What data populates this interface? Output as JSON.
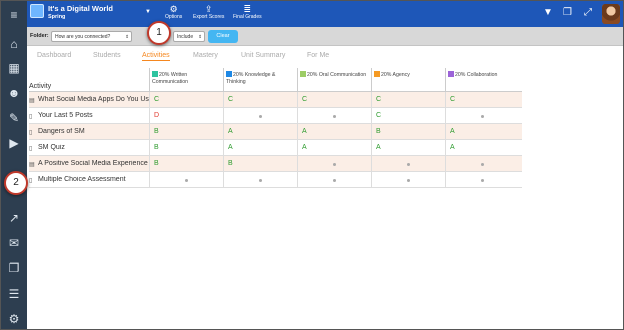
{
  "header": {
    "class_title": "It's a Digital World",
    "class_subtitle": "Spring",
    "buttons": [
      {
        "label": "Options",
        "icon": "gears-icon"
      },
      {
        "label": "Export Scores",
        "icon": "upload-icon"
      },
      {
        "label": "Final Grades",
        "icon": "list-icon"
      }
    ],
    "right_icons": [
      "filter-icon",
      "copy-icon",
      "expand-icon"
    ]
  },
  "filters": {
    "folder_label": "Folder:",
    "folder_value": "How are you connected?",
    "include_value": "Include",
    "clear_label": "Clear"
  },
  "tabs": [
    {
      "label": "Dashboard",
      "active": false
    },
    {
      "label": "Students",
      "active": false
    },
    {
      "label": "Activities",
      "active": true
    },
    {
      "label": "Mastery",
      "active": false
    },
    {
      "label": "Unit Summary",
      "active": false
    },
    {
      "label": "For Me",
      "active": false
    }
  ],
  "table": {
    "activity_header": "Activity",
    "columns": [
      {
        "label": "20% Written Communication",
        "color": "#2ec4a0"
      },
      {
        "label": "20% Knowledge & Thinking",
        "color": "#1e88e5"
      },
      {
        "label": "20% Oral Communication",
        "color": "#9ccc65"
      },
      {
        "label": "20% Agency",
        "color": "#f59a23"
      },
      {
        "label": "20% Collaboration",
        "color": "#9c64d8"
      }
    ],
    "rows": [
      {
        "name": "What Social Media Apps Do You Use?",
        "type": "book-icon",
        "cells": [
          "C",
          "C",
          "C",
          "C",
          "C"
        ]
      },
      {
        "name": "Your Last 5 Posts",
        "type": "doc-icon",
        "cells": [
          "D",
          "•",
          "•",
          "C",
          "•"
        ]
      },
      {
        "name": "Dangers of SM",
        "type": "doc-icon",
        "cells": [
          "B",
          "A",
          "A",
          "B",
          "A"
        ]
      },
      {
        "name": "SM Quiz",
        "type": "doc-icon",
        "cells": [
          "B",
          "A",
          "A",
          "A",
          "A"
        ]
      },
      {
        "name": "A Positive Social Media Experience",
        "type": "book-icon",
        "cells": [
          "B",
          "B",
          "•",
          "•",
          "•"
        ]
      },
      {
        "name": "Multiple Choice Assessment",
        "type": "doc-icon",
        "cells": [
          "•",
          "•",
          "•",
          "•",
          "•"
        ]
      }
    ]
  },
  "grade_colors": {
    "A": "#2e9b2e",
    "B": "#2e9b2e",
    "C": "#2e9b2e",
    "D": "#e03a2e"
  },
  "callouts": [
    {
      "number": "1"
    },
    {
      "number": "2"
    }
  ]
}
